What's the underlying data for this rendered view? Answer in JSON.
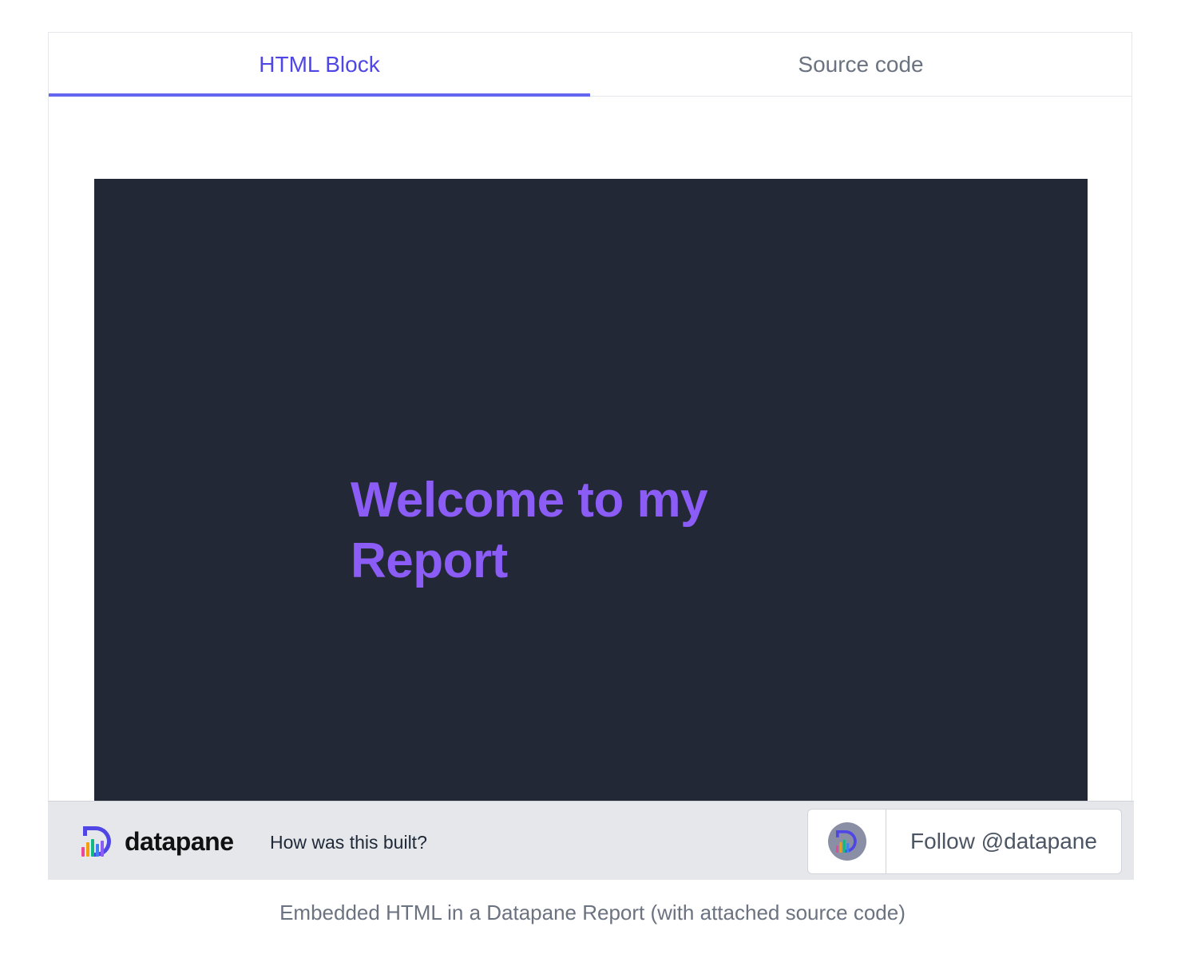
{
  "tabs": [
    {
      "label": "HTML Block",
      "active": true
    },
    {
      "label": "Source code",
      "active": false
    }
  ],
  "content": {
    "heading": "Welcome to my Report",
    "background": "#222836",
    "heading_color": "#8b5cf6"
  },
  "footer": {
    "brand": "datapane",
    "brand_icon": "datapane-logo-icon",
    "link": "How was this built?",
    "follow_label": "Follow @datapane",
    "follow_icon": "datapane-avatar-icon"
  },
  "caption": "Embedded HTML in a Datapane Report (with attached source code)",
  "colors": {
    "accent": "#4f46e5",
    "tab_underline": "#6366f1",
    "footer_bg": "#e5e7eb"
  }
}
